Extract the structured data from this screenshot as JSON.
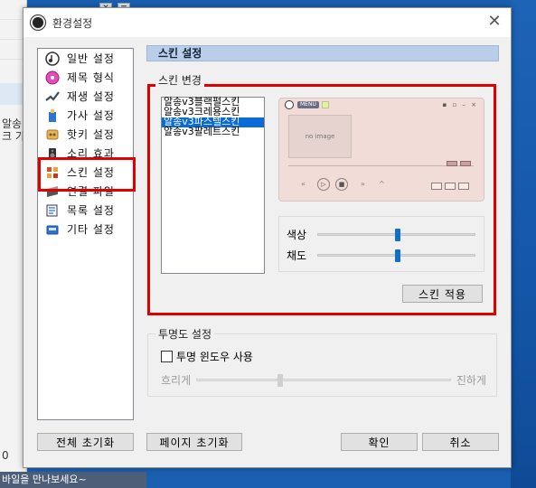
{
  "background": {
    "left_text_1": "알송",
    "left_text_2": "크 가",
    "left_number": "0",
    "bottom_banner": "바일을 만나보세요~"
  },
  "dialog": {
    "title": "환경설정",
    "close_label": "✕"
  },
  "nav": {
    "items": [
      {
        "label": "일반 설정",
        "icon": "music-note-icon"
      },
      {
        "label": "제목 형식",
        "icon": "cd-icon"
      },
      {
        "label": "재생 설정",
        "icon": "play-wave-icon"
      },
      {
        "label": "가사 설정",
        "icon": "lyrics-icon"
      },
      {
        "label": "핫키 설정",
        "icon": "hotkey-icon"
      },
      {
        "label": "소리 효과",
        "icon": "speaker-icon"
      },
      {
        "label": "스킨 설정",
        "icon": "skin-icon"
      },
      {
        "label": "연결 파일",
        "icon": "file-link-icon"
      },
      {
        "label": "목록 설정",
        "icon": "list-icon"
      },
      {
        "label": "기타 설정",
        "icon": "misc-icon"
      }
    ]
  },
  "panel": {
    "header": "스킨 설정",
    "skin_change_label": "스킨 변경",
    "skins": [
      "알송v3블랙펄스킨",
      "알송v3크레용스킨",
      "알송v3파스텔스킨",
      "알송v3팔레트스킨"
    ],
    "selected_skin_index": 2,
    "preview": {
      "menu_label": "MENU",
      "no_image_label": "no image"
    },
    "hue_label": "색상",
    "saturation_label": "채도",
    "hue_value": 0.5,
    "saturation_value": 0.5,
    "apply_button": "스킨 적용",
    "transparency_label": "투명도 설정",
    "transparent_window_label": "투명 윈도우 사용",
    "transparent_window_checked": false,
    "blur_label": "흐리게",
    "dark_label": "진하게",
    "transparency_value": 0.35
  },
  "footer": {
    "reset_all": "전체 초기화",
    "reset_page": "페이지 초기화",
    "ok": "확인",
    "cancel": "취소"
  },
  "colors": {
    "accent": "#0a6bd8",
    "highlight_box": "#e00000",
    "section_header": "#b9cfe9",
    "preview_bg": "#f1dcd7"
  }
}
